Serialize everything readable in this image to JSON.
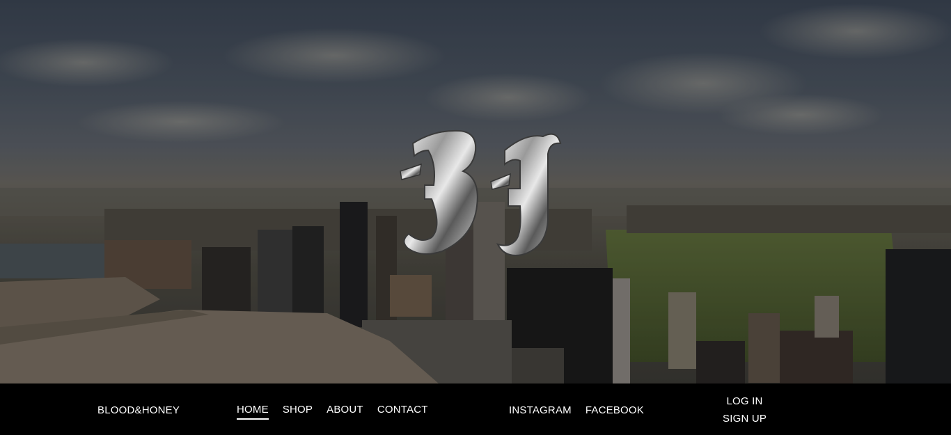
{
  "hero": {
    "background": "city-skyline-photo",
    "logo": {
      "icon": "bh-chrome-monogram",
      "letters": "BH"
    }
  },
  "nav_bar": {
    "brand": "BLOOD&HONEY",
    "menu": [
      {
        "label": "HOME",
        "active": true
      },
      {
        "label": "SHOP",
        "active": false
      },
      {
        "label": "ABOUT",
        "active": false
      },
      {
        "label": "CONTACT",
        "active": false
      }
    ],
    "social": [
      {
        "label": "INSTAGRAM"
      },
      {
        "label": "FACEBOOK"
      }
    ],
    "auth": {
      "login": "LOG IN",
      "signup": "SIGN UP"
    }
  },
  "colors": {
    "bar": "#000000",
    "text": "#ffffff"
  }
}
